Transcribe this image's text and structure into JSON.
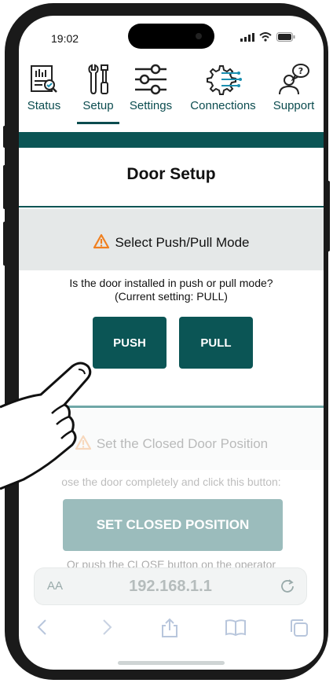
{
  "status_bar": {
    "time": "19:02"
  },
  "nav": {
    "items": [
      {
        "label": "Status",
        "icon": "status-report-icon"
      },
      {
        "label": "Setup",
        "icon": "tools-icon"
      },
      {
        "label": "Settings",
        "icon": "sliders-icon"
      },
      {
        "label": "Connections",
        "icon": "gear-connections-icon"
      },
      {
        "label": "Support",
        "icon": "support-person-icon"
      }
    ],
    "active": "Setup"
  },
  "page_title": "Door Setup",
  "push_pull": {
    "heading": "Select Push/Pull Mode",
    "question": "Is the door installed in push or pull mode?",
    "current_setting": "(Current setting: PULL)",
    "push_label": "PUSH",
    "pull_label": "PULL"
  },
  "closed_position": {
    "heading": "Set the Closed Door Position",
    "instruction": "ose the door completely and click this button:",
    "button_label": "SET CLOSED POSITION",
    "after_text": "Or push the CLOSE button on the operator"
  },
  "browser": {
    "aa_label": "AA",
    "url": "192.168.1.1"
  },
  "colors": {
    "accent": "#0b5555",
    "warning": "#f08020"
  }
}
